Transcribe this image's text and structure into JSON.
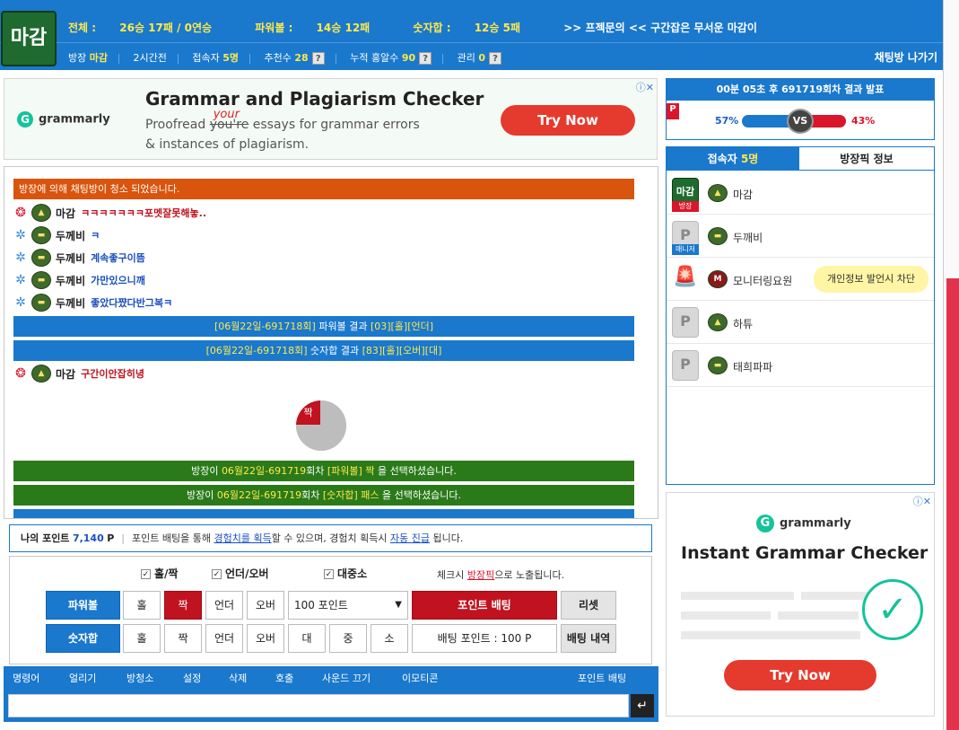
{
  "header": {
    "logo_text": "마감",
    "stats": [
      {
        "label": "전체 : ",
        "value": "26승 17패 / 0연승"
      },
      {
        "label": "파워볼 : ",
        "value": "14승 12패"
      },
      {
        "label": "숫자합 : ",
        "value": "12승 5패"
      }
    ],
    "title": ">> 프젝문의 << 구간잡은 무서운 마감이",
    "owner_label": "방장",
    "owner_name": "마감",
    "duration": "2시간전",
    "viewers_label": "접속자",
    "viewers_value": "5명",
    "recommend_label": "추천수",
    "recommend_value": "28",
    "hits_label": "누적 홍알수",
    "hits_value": "90",
    "manage_label": "관리",
    "manage_value": "0",
    "help": "?",
    "leave_label": "채팅방 나가기"
  },
  "ad_top": {
    "brand": "grammarly",
    "glogo": "G",
    "title": "Grammar and Plagiarism Checker",
    "line1_a": "Proofread ",
    "line1_strike": "you're",
    "line1_your": "your",
    "line1_b": " essays for grammar errors",
    "line2": "& instances of plagiarism.",
    "cta": "Try Now",
    "adchoice": "ⓘ✕"
  },
  "result": {
    "title": "00분 05초 후 691719회차 결과 발표",
    "flag": "P",
    "left_pct": "57%",
    "right_pct": "43%",
    "vs": "VS",
    "left_share": 57
  },
  "users": {
    "tab_users_label": "접속자",
    "tab_users_count": "5명",
    "tab_pick": "방장픽 정보",
    "list": [
      {
        "avatar": "마감",
        "badge": "방장",
        "name": "마감"
      },
      {
        "avatar": "P",
        "badge": "매니저",
        "name": "두깨비"
      },
      {
        "avatar": "🚨",
        "name": "모니터링요원",
        "level": "M",
        "tip": "개인정보 발언시 차단"
      },
      {
        "avatar": "P",
        "name": "하튜"
      },
      {
        "avatar": "P",
        "name": "태희파파"
      }
    ]
  },
  "chat": {
    "notice": "방장에 의해 채팅방이 청소 되었습니다.",
    "messages": [
      {
        "name": "마감",
        "text": "ㅋㅋㅋㅋㅋㅋㅋ포멧잘못해놓.."
      },
      {
        "name": "두께비",
        "text": "ㅋ"
      },
      {
        "name": "두께비",
        "text": "계속좋구이뜸"
      },
      {
        "name": "두께비",
        "text": "가만있으니깨"
      },
      {
        "name": "두께비",
        "text": "좋았다쨨다반그복ㅋ"
      }
    ],
    "result1_round": "[06월22일-691718회]",
    "result1_text": " 파워볼 결과 ",
    "result1_value": "[03][홀][언더]",
    "result2_round": "[06월22일-691718회]",
    "result2_text": " 숫자합 결과 ",
    "result2_value": "[83][홀][오버][대]",
    "msg6_name": "마감",
    "msg6_text": "구간이안잡히녕",
    "pie_label": "짝",
    "pick1_a": "방장이 ",
    "pick1_round": "06월22일-691719",
    "pick1_b": "회차 ",
    "pick1_pick": "[파워볼] 짝",
    "pick1_c": " 을 선택하셨습니다.",
    "pick2_a": "방장이 ",
    "pick2_round": "06월22일-691719",
    "pick2_b": "회차 ",
    "pick2_pick": "[숫자합] 패스",
    "pick2_c": " 을 선택하셨습니다."
  },
  "points": {
    "label": "나의 포인트",
    "value": "7,140",
    "unit": "P",
    "sep": "|",
    "desc_a": "포인트 배팅을 통해 ",
    "link1": "경험치를 획득",
    "desc_b": "할 수 있으며, 경험치 획득시 ",
    "link2": "자동 진급",
    "desc_c": " 됩니다."
  },
  "bet": {
    "check1": "홀/짝",
    "check2": "언더/오버",
    "check3": "대중소",
    "checkmark": "✓",
    "note_a": "체크시 ",
    "note_link": "방장픽",
    "note_b": "으로 노출됩니다.",
    "row1_label": "파워볼",
    "odd": "홀",
    "even": "짝",
    "under": "언더",
    "over": "오버",
    "select_value": "100 포인트",
    "select_arrow": "▼",
    "bet_button": "포인트 배팅",
    "reset_button": "리셋",
    "row2_label": "숫자합",
    "big": "대",
    "mid": "중",
    "small": "소",
    "bet_points": "배팅 포인트 : 100 P",
    "history_button": "배팅 내역"
  },
  "bottom": {
    "items": [
      "명령어",
      "얼리기",
      "방청소",
      "설정",
      "삭제",
      "호출",
      "사운드 끄기",
      "이모티콘"
    ],
    "point_bet": "포인트 배팅",
    "send_icon": "↵"
  },
  "ad_side": {
    "brand": "grammarly",
    "glogo": "G",
    "title": "Instant Grammar Checker",
    "check": "✓",
    "cta": "Try Now",
    "adchoice": "ⓘ✕"
  },
  "colors": {
    "primary": "#1a78cd",
    "red": "#c1121f",
    "green": "#2a7a1a",
    "orange": "#d9540c",
    "yellow": "#ffe94a"
  }
}
